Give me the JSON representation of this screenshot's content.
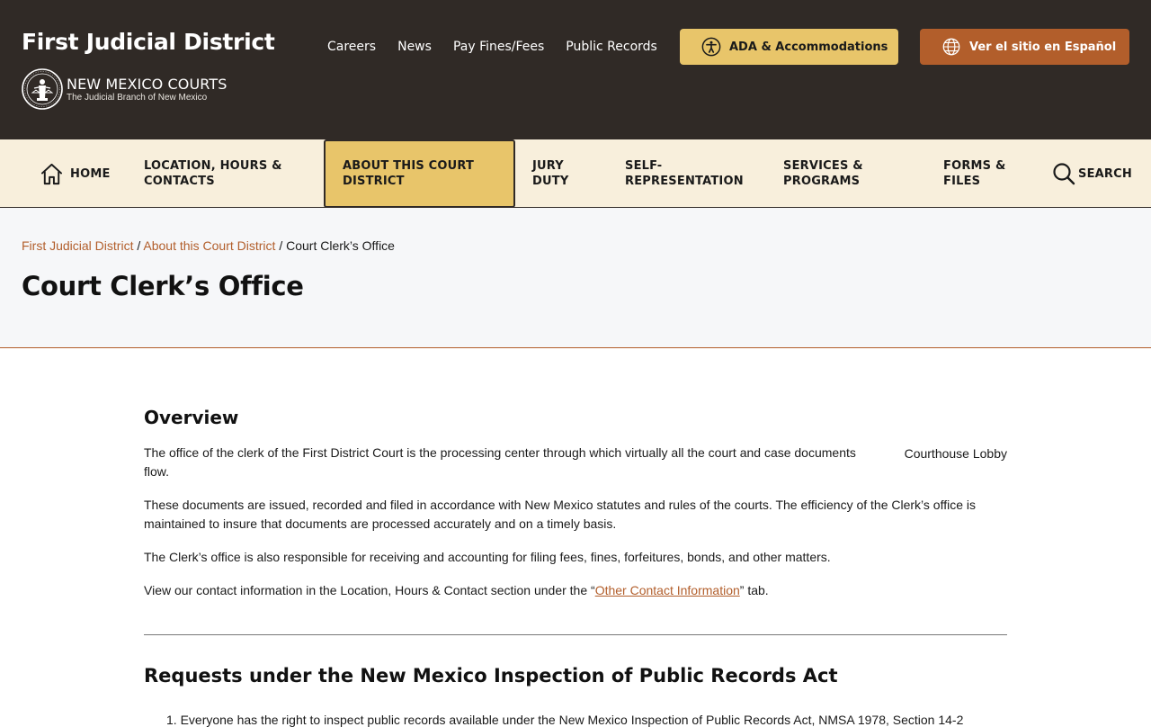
{
  "header": {
    "site_title": "First Judicial District",
    "brand_name": "NEW MEXICO COURTS",
    "brand_sub": "The Judicial Branch of New Mexico",
    "links": [
      {
        "label": "Careers"
      },
      {
        "label": "News"
      },
      {
        "label": "Pay Fines/Fees"
      },
      {
        "label": "Public Records"
      }
    ],
    "ada_label": "ADA & Accommodations",
    "spanish_label": "Ver el sitio en Español"
  },
  "nav": {
    "home": "HOME",
    "location": "LOCATION, HOURS & CONTACTS",
    "about": "ABOUT THIS COURT DISTRICT",
    "jury": "JURY DUTY",
    "self": "SELF-REPRESENTATION",
    "services": "SERVICES & PROGRAMS",
    "forms": "FORMS & FILES",
    "search": "SEARCH"
  },
  "breadcrumb": {
    "items": [
      {
        "label": "First Judicial District"
      },
      {
        "label": "About this Court District"
      }
    ],
    "separator": " / ",
    "current": "Court Clerk’s Office"
  },
  "page": {
    "title": "Court Clerk’s Office"
  },
  "overview": {
    "heading": "Overview",
    "p1": "The office of the clerk of the First District Court is the processing center through which virtually all the court and case documents flow.",
    "image_alt": "Courthouse Lobby",
    "p2": "These documents are issued, recorded and filed in accordance with New Mexico statutes and rules of the courts. The efficiency of the Clerk’s office is maintained to insure that documents are processed accurately and on a timely basis.",
    "p3": "The Clerk’s office is also responsible for receiving and accounting for filing fees, fines, forfeitures, bonds, and other matters.",
    "p4_before": "View our contact information in the Location, Hours & Contact section under the “",
    "p4_link": "Other Contact Information",
    "p4_after": "” tab."
  },
  "ipra": {
    "heading": "Requests under the New Mexico Inspection of Public Records Act",
    "list_peek": "1.  Everyone has the right to inspect public records available under the New Mexico Inspection of Public Records Act, NMSA 1978, Section 14-2"
  },
  "colors": {
    "header_bg": "#302a26",
    "accent_gold": "#e8c56a",
    "accent_rust": "#b25e2b",
    "nav_bg": "#f8efdc"
  },
  "icons": {
    "home": "home-icon",
    "search": "search-icon",
    "accessibility": "accessibility-icon",
    "globe": "globe-icon",
    "seal": "court-seal-icon"
  }
}
